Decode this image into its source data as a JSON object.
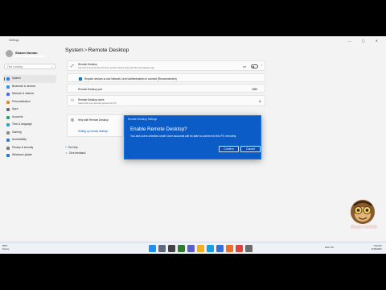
{
  "window": {
    "app_name": "Settings",
    "controls": "— ▢ ✕"
  },
  "profile": {
    "name": "Shawn Noman"
  },
  "search": {
    "placeholder": "Find a setting"
  },
  "nav": {
    "items": [
      {
        "label": "System",
        "color": "#2b7fd8",
        "active": true
      },
      {
        "label": "Bluetooth & devices",
        "color": "#3a8de0"
      },
      {
        "label": "Network & internet",
        "color": "#4c6ef5"
      },
      {
        "label": "Personalization",
        "color": "#e58a2f"
      },
      {
        "label": "Apps",
        "color": "#6a6a6a"
      },
      {
        "label": "Accounts",
        "color": "#2fa36b"
      },
      {
        "label": "Time & language",
        "color": "#3a9ad9"
      },
      {
        "label": "Gaming",
        "color": "#8a8a8a"
      },
      {
        "label": "Accessibility",
        "color": "#3676c9"
      },
      {
        "label": "Privacy & security",
        "color": "#7a7a7a"
      },
      {
        "label": "Windows Update",
        "color": "#1e7ad6"
      }
    ]
  },
  "heading": {
    "parent": "System",
    "separator": ">",
    "page": "Remote Desktop"
  },
  "remote_desktop": {
    "title": "Remote Desktop",
    "subtitle": "Connect to and use this PC from another device using the Remote Desktop app",
    "toggle_label": "Off",
    "nla_label": "Require devices to use Network Level Authentication to connect (Recommended)",
    "port_label": "Remote Desktop port",
    "port_value": "3389"
  },
  "users": {
    "title": "Remote Desktop users",
    "subtitle": "Select who can remotely access this PC"
  },
  "help": {
    "title": "Help with Remote Desktop",
    "link": "Setting up remote desktop"
  },
  "footer_links": {
    "get_help": "Get help",
    "feedback": "Give feedback"
  },
  "dialog": {
    "caption": "Remote Desktop Settings",
    "title": "Enable Remote Desktop?",
    "body": "You and users selected under User accounts will be able to connect to this PC remotely.",
    "confirm": "Confirm",
    "cancel": "Cancel"
  },
  "branding": {
    "name": "Shawn TechBD"
  },
  "taskbar": {
    "weather_temp": "59°F",
    "weather_text": "Sunny",
    "tray": "ENG\nUS",
    "time": "7:00 AM",
    "date": "6/15/2023",
    "icons": [
      {
        "name": "windows-start-icon",
        "color": "#1f8ef1"
      },
      {
        "name": "search-icon",
        "color": "#5f6b7a"
      },
      {
        "name": "task-view-icon",
        "color": "#444444"
      },
      {
        "name": "widgets-icon",
        "color": "#2e7d32"
      },
      {
        "name": "chat-icon",
        "color": "#5b5fc7"
      },
      {
        "name": "file-explorer-icon",
        "color": "#f2b01e"
      },
      {
        "name": "edge-icon",
        "color": "#1b9de2"
      },
      {
        "name": "store-icon",
        "color": "#3a6fd8"
      },
      {
        "name": "firefox-icon",
        "color": "#e8702a"
      },
      {
        "name": "chrome-icon",
        "color": "#d9473c"
      },
      {
        "name": "settings-icon",
        "color": "#6b6b6b"
      }
    ]
  }
}
